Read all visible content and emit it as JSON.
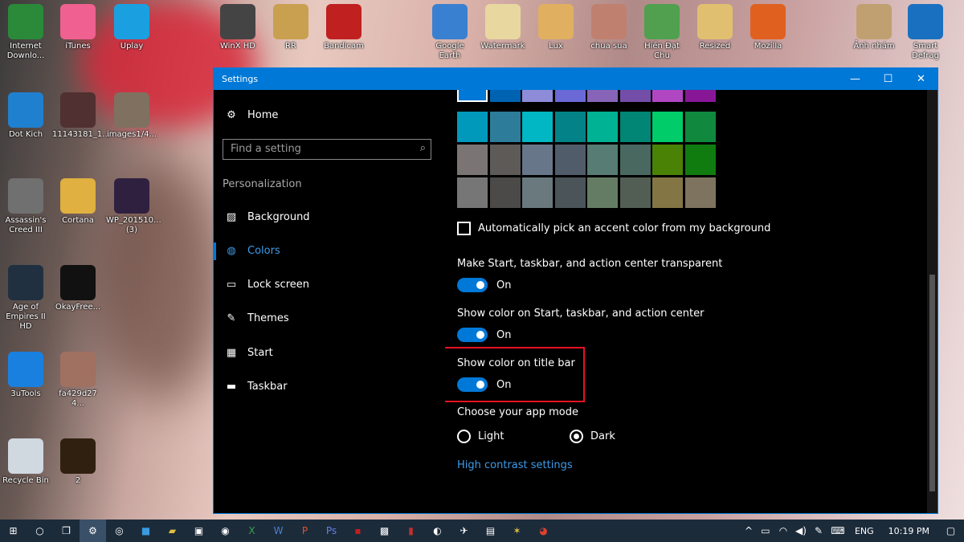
{
  "desktop": {
    "icons": [
      {
        "label": "Internet Downlo...",
        "color": "#2a8a3a"
      },
      {
        "label": "iTunes",
        "color": "#f06090"
      },
      {
        "label": "Uplay",
        "color": "#1aa0e0"
      },
      {
        "label": "WinX HD",
        "color": "#444"
      },
      {
        "label": "RR",
        "color": "#c9a050"
      },
      {
        "label": "Bandicam",
        "color": "#c02020"
      },
      {
        "label": "Google Earth",
        "color": "#3a80d0"
      },
      {
        "label": "Watermark",
        "color": "#e8d8a0"
      },
      {
        "label": "Lux",
        "color": "#e0b060"
      },
      {
        "label": "chua sua",
        "color": "#c08070"
      },
      {
        "label": "Hiền Đạt Chu",
        "color": "#50a050"
      },
      {
        "label": "Resized",
        "color": "#e0c070"
      },
      {
        "label": "Mozilla",
        "color": "#e06020"
      },
      {
        "label": "Ảnh nhám",
        "color": "#c0a070"
      },
      {
        "label": "Smart Defrag",
        "color": "#1a70c0"
      },
      {
        "label": "Dot Kich",
        "color": "#2080d0"
      },
      {
        "label": "11143181_1...",
        "color": "#503030"
      },
      {
        "label": "images1/4...",
        "color": "#807060"
      },
      {
        "label": "Assassin's Creed III",
        "color": "#707070"
      },
      {
        "label": "Cortana",
        "color": "#e0b040"
      },
      {
        "label": "WP_201510... (3)",
        "color": "#302040"
      },
      {
        "label": "Age of Empires II HD",
        "color": "#203040"
      },
      {
        "label": "OkayFree...",
        "color": "#111"
      },
      {
        "label": "3uTools",
        "color": "#1a80e0"
      },
      {
        "label": "fa429d27 4...",
        "color": "#a07060"
      },
      {
        "label": "Recycle Bin",
        "color": "#d0d8e0"
      },
      {
        "label": "2",
        "color": "#302010"
      }
    ]
  },
  "window": {
    "title": "Settings",
    "minimize": "—",
    "maximize": "☐",
    "close": "✕",
    "accent": "#0078d7"
  },
  "nav": {
    "home": "Home",
    "search_placeholder": "Find a setting",
    "section": "Personalization",
    "items": [
      {
        "label": "Background",
        "icon": "picture-icon"
      },
      {
        "label": "Colors",
        "icon": "palette-icon",
        "active": true
      },
      {
        "label": "Lock screen",
        "icon": "lock-screen-icon"
      },
      {
        "label": "Themes",
        "icon": "brush-icon"
      },
      {
        "label": "Start",
        "icon": "start-icon"
      },
      {
        "label": "Taskbar",
        "icon": "taskbar-icon"
      }
    ]
  },
  "colors": {
    "swatches": [
      [
        "#0078d7",
        "#0063b1",
        "#8e8cd8",
        "#6b69d6",
        "#8764b8",
        "#744da9",
        "#b146c2",
        "#881798"
      ],
      [
        "#0099bc",
        "#2d7d9a",
        "#00b7c3",
        "#038387",
        "#00b294",
        "#018574",
        "#00cc6a",
        "#10893e"
      ],
      [
        "#7a7574",
        "#5d5a58",
        "#68768a",
        "#515c6b",
        "#567c73",
        "#486860",
        "#498205",
        "#107c10"
      ],
      [
        "#767676",
        "#4c4a48",
        "#69797e",
        "#4a5459",
        "#647c64",
        "#525e54",
        "#847545",
        "#7e735f"
      ]
    ],
    "auto_pick": "Automatically pick an accent color from my background",
    "auto_pick_checked": false,
    "transparent_label": "Make Start, taskbar, and action center transparent",
    "transparent_state": "On",
    "show_start_label": "Show color on Start, taskbar, and action center",
    "show_start_state": "On",
    "title_bar_label": "Show color on title bar",
    "title_bar_state": "On",
    "app_mode_label": "Choose your app mode",
    "light": "Light",
    "dark": "Dark",
    "selected_mode": "Dark",
    "high_contrast": "High contrast settings",
    "highlight_color": "#e81123"
  },
  "taskbar": {
    "lang": "ENG",
    "time": "10:19 PM"
  }
}
